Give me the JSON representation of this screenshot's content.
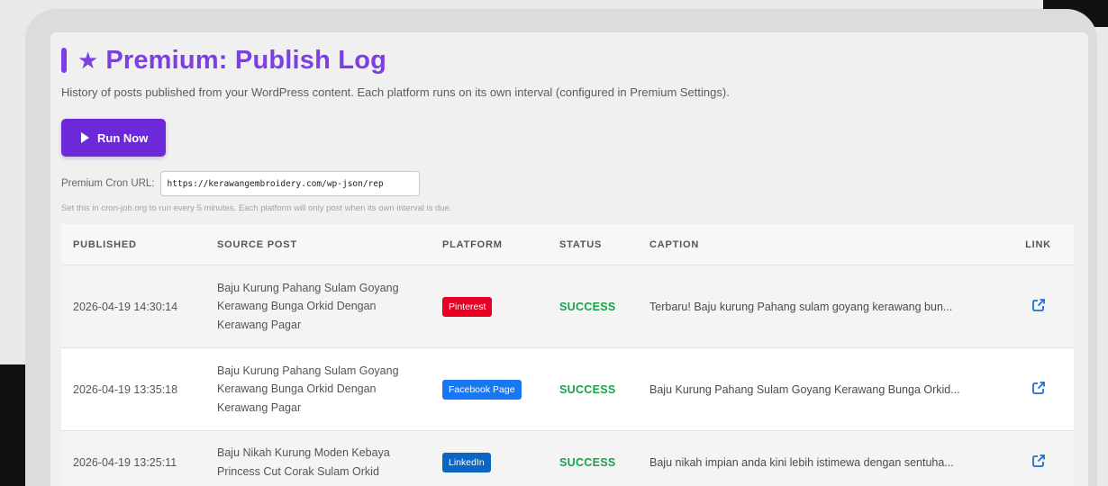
{
  "header": {
    "star": "★",
    "title": "Premium: Publish Log",
    "subtitle": "History of posts published from your WordPress content. Each platform runs on its own interval (configured in Premium Settings)."
  },
  "actions": {
    "run_now_label": "Run Now"
  },
  "cron": {
    "label": "Premium Cron URL:",
    "url_value": "https://kerawangembroidery.com/wp-json/rep",
    "help": "Set this in cron-job.org to run every 5 minutes. Each platform will only post when its own interval is due."
  },
  "table": {
    "columns": {
      "published": "PUBLISHED",
      "source": "SOURCE POST",
      "platform": "PLATFORM",
      "status": "STATUS",
      "caption": "CAPTION",
      "link": "LINK"
    },
    "rows": [
      {
        "published": "2026-04-19 14:30:14",
        "source": "Baju Kurung Pahang Sulam Goyang Kerawang Bunga Orkid Dengan Kerawang Pagar",
        "platform": "Pinterest",
        "platform_color": "#e60023",
        "status": "SUCCESS",
        "caption": "Terbaru! Baju kurung Pahang sulam goyang kerawang bun...",
        "link_icon": "external-link-icon"
      },
      {
        "published": "2026-04-19 13:35:18",
        "source": "Baju Kurung Pahang Sulam Goyang Kerawang Bunga Orkid Dengan Kerawang Pagar",
        "platform": "Facebook Page",
        "platform_color": "#1877f2",
        "status": "SUCCESS",
        "caption": "Baju Kurung Pahang Sulam Goyang Kerawang Bunga Orkid...",
        "link_icon": "external-link-icon"
      },
      {
        "published": "2026-04-19 13:25:11",
        "source": "Baju Nikah Kurung Moden Kebaya Princess Cut Corak Sulam Orkid",
        "platform": "LinkedIn",
        "platform_color": "#0a66c2",
        "status": "SUCCESS",
        "caption": "Baju nikah impian anda kini lebih istimewa dengan sentuha...",
        "link_icon": "external-link-icon"
      }
    ]
  },
  "colors": {
    "accent": "#7b3fe4",
    "success": "#16a34a"
  }
}
